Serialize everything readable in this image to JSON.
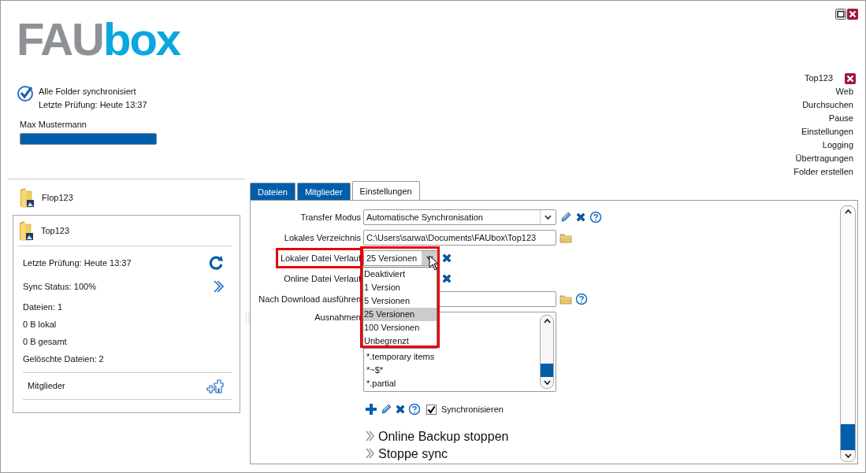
{
  "logo": {
    "grey": "FAU",
    "blue": "box"
  },
  "status": {
    "synced": true,
    "lines": [
      "Alle Folder synchronisiert",
      "Letzte Prüfung: Heute 13:37"
    ]
  },
  "user": {
    "name": "Max Mustermann",
    "quota": {
      "level": 1
    }
  },
  "account_menu": {
    "title": "Top123",
    "items": [
      "Web",
      "Durchsuchen",
      "Pause",
      "Einstellungen",
      "Logging",
      "Übertragungen",
      "Folder erstellen"
    ]
  },
  "folders": [
    {
      "name": "Flop123",
      "expanded": false
    },
    {
      "name": "Top123",
      "expanded": true,
      "details": [
        {
          "text": "Letzte Prüfung: Heute 13:37",
          "kind": "refresh"
        },
        {
          "text": "Sync Status: 100%",
          "kind": "open"
        },
        {
          "text": "Dateien: 1",
          "kind": "info"
        },
        {
          "text": "0 B lokal",
          "kind": "info"
        },
        {
          "text": "0 B gesamt",
          "kind": "info"
        },
        {
          "text": "Gelöschte Dateien: 2",
          "kind": "info"
        }
      ],
      "members_label": "Mitglieder"
    }
  ],
  "tabs": [
    {
      "label": "Dateien",
      "selected": false
    },
    {
      "label": "Mitglieder",
      "selected": false
    },
    {
      "label": "Einstellungen",
      "selected": true
    }
  ],
  "settings": {
    "fields": [
      {
        "kind": "combo",
        "label": "Transfer Modus",
        "value": "Automatische Synchronisation",
        "icons": [
          {
            "kind": "edit"
          },
          {
            "kind": "remove"
          },
          {
            "kind": "help"
          }
        ],
        "highlighted": false
      },
      {
        "kind": "text",
        "label": "Lokales Verzeichnis",
        "value": "C:\\Users\\sarwa\\Documents\\FAUbox\\Top123",
        "icons": [
          {
            "kind": "folder"
          }
        ],
        "highlighted": false
      },
      {
        "kind": "select",
        "label": "Lokaler Datei Verlauf",
        "value": "25 Versionen",
        "icons": [
          {
            "kind": "remove"
          }
        ],
        "highlighted": true,
        "open": true,
        "options": [
          {
            "label": "Deaktiviert",
            "selected": false
          },
          {
            "label": "1 Version",
            "selected": false
          },
          {
            "label": "5 Versionen",
            "selected": false
          },
          {
            "label": "25 Versionen",
            "selected": true
          },
          {
            "label": "100 Versionen",
            "selected": false
          },
          {
            "label": "Unbegrenzt",
            "selected": false
          }
        ]
      },
      {
        "kind": "select",
        "label": "Online Datei Verlauf",
        "icons": [
          {
            "kind": "remove"
          }
        ],
        "highlighted": false
      },
      {
        "kind": "text",
        "label": "Nach Download ausführen",
        "icons": [
          {
            "kind": "folder"
          },
          {
            "kind": "help"
          }
        ],
        "highlighted": false
      },
      {
        "kind": "list",
        "label": "Ausnahmen",
        "items": [
          "*.temporary items",
          "*~$*",
          "*.partial"
        ],
        "highlighted": false
      }
    ],
    "list_tools": [
      {
        "kind": "add"
      },
      {
        "kind": "edit"
      },
      {
        "kind": "remove"
      },
      {
        "kind": "help"
      }
    ],
    "sync_checkbox": {
      "label": "Synchronisieren",
      "checked": true
    },
    "actions": [
      "Online Backup stoppen",
      "Stoppe sync"
    ]
  }
}
